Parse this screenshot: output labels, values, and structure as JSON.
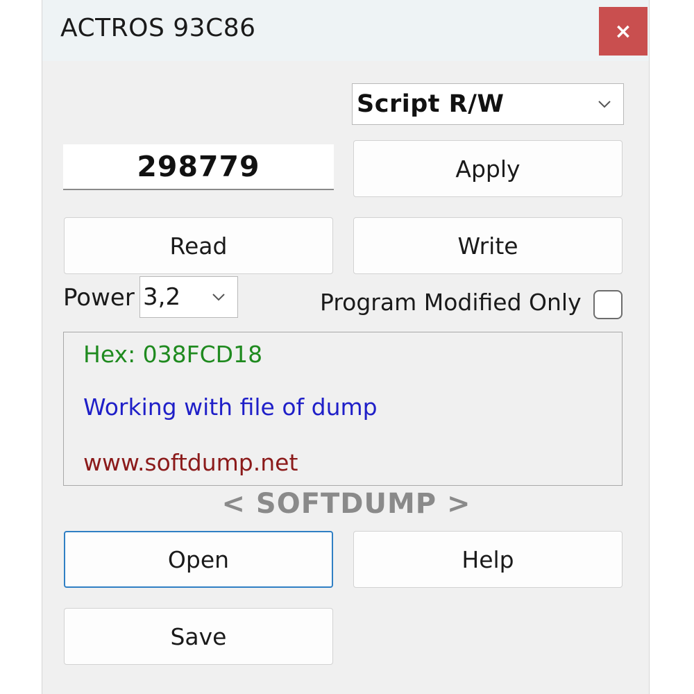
{
  "window": {
    "title": "ACTROS 93C86",
    "close_label": "×"
  },
  "script_select": {
    "value": "Script R/W"
  },
  "code_field": {
    "value": "298779"
  },
  "buttons": {
    "apply": "Apply",
    "read": "Read",
    "write": "Write",
    "open": "Open",
    "help": "Help",
    "save": "Save"
  },
  "power": {
    "label": "Power",
    "value": "3,2"
  },
  "program_modified_only": {
    "label": "Program Modified Only",
    "checked": false
  },
  "log": {
    "lines": [
      {
        "text": "Hex: 038FCD18",
        "color": "#1f8a1f"
      },
      {
        "text": "Working with file of dump",
        "color": "#1f1fc8"
      },
      {
        "text": "www.softdump.net",
        "color": "#8b1a1a"
      }
    ]
  },
  "brand": {
    "text": "< SOFTDUMP >"
  },
  "colors": {
    "close_bg": "#c94f4f",
    "focus_border": "#2f7fc4"
  },
  "icons": {
    "dropdown": "chevron-down-icon",
    "close": "close-icon"
  }
}
